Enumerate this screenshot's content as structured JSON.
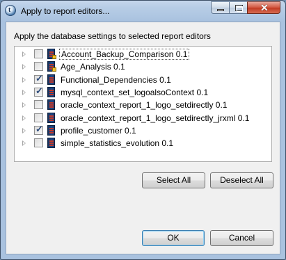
{
  "window": {
    "title": "Apply to report editors..."
  },
  "dialog": {
    "prompt": "Apply the database settings to selected report editors",
    "items": [
      {
        "label": "Account_Backup_Comparison 0.1",
        "checked": false,
        "locked": true,
        "selected": true
      },
      {
        "label": "Age_Analysis 0.1",
        "checked": false,
        "locked": true,
        "selected": false
      },
      {
        "label": "Functional_Dependencies 0.1",
        "checked": true,
        "locked": false,
        "selected": false
      },
      {
        "label": "mysql_context_set_logoalsoContext 0.1",
        "checked": true,
        "locked": false,
        "selected": false
      },
      {
        "label": "oracle_context_report_1_logo_setdirectly 0.1",
        "checked": false,
        "locked": false,
        "selected": false
      },
      {
        "label": "oracle_context_report_1_logo_setdirectly_jrxml 0.1",
        "checked": false,
        "locked": false,
        "selected": false
      },
      {
        "label": "profile_customer 0.1",
        "checked": true,
        "locked": false,
        "selected": false
      },
      {
        "label": "simple_statistics_evolution 0.1",
        "checked": false,
        "locked": false,
        "selected": false
      }
    ],
    "select_all_label": "Select All",
    "deselect_all_label": "Deselect All",
    "ok_label": "OK",
    "cancel_label": "Cancel"
  }
}
